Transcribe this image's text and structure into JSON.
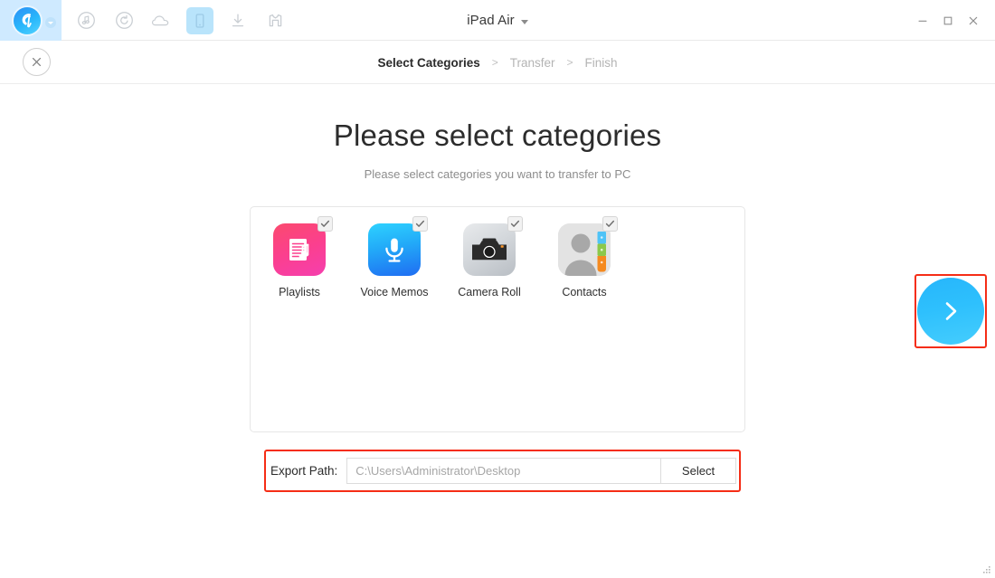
{
  "window": {
    "device_name": "iPad Air",
    "device_caret_icon": "chevron-down-icon",
    "minimize_icon": "minimize-icon",
    "maximize_icon": "maximize-icon",
    "close_icon": "close-icon"
  },
  "logo": {
    "name": "anytrans-logo",
    "letter": "A",
    "dropdown_icon": "caret-down-icon",
    "colors": {
      "start": "#2a8ef5",
      "end": "#54d3ff",
      "zone_bg": "#cfeaff"
    }
  },
  "toolbar": {
    "items": [
      {
        "name": "music-icon",
        "label": "Music",
        "active": false
      },
      {
        "name": "backup-restore-icon",
        "label": "Backup Manager",
        "active": false
      },
      {
        "name": "cloud-icon",
        "label": "Cloud",
        "active": false
      },
      {
        "name": "device-icon",
        "label": "Device Manager",
        "active": true
      },
      {
        "name": "download-icon",
        "label": "Media Downloader",
        "active": false
      },
      {
        "name": "app-downloader-icon",
        "label": "App Downloader",
        "active": false
      }
    ],
    "active_bg": "#b9e4fb"
  },
  "stepbar": {
    "close_button_icon": "close-circle-icon",
    "separator": ">",
    "steps": [
      {
        "label": "Select Categories",
        "current": true
      },
      {
        "label": "Transfer",
        "current": false
      },
      {
        "label": "Finish",
        "current": false
      }
    ]
  },
  "main": {
    "heading": "Please select categories",
    "subheading": "Please select categories you want to transfer to PC",
    "categories": [
      {
        "label": "Playlists",
        "icon": "playlists-icon",
        "checked": true,
        "style": "ic-playlists"
      },
      {
        "label": "Voice Memos",
        "icon": "voice-memos-icon",
        "checked": true,
        "style": "ic-voicememos"
      },
      {
        "label": "Camera Roll",
        "icon": "camera-roll-icon",
        "checked": true,
        "style": "ic-cameraroll"
      },
      {
        "label": "Contacts",
        "icon": "contacts-icon",
        "checked": true,
        "style": "ic-contacts"
      }
    ],
    "check_glyph": "checkmark-icon"
  },
  "export": {
    "label": "Export Path:",
    "path_value": "C:\\Users\\Administrator\\Desktop",
    "select_label": "Select"
  },
  "next_button": {
    "name": "next-arrow-button",
    "icon": "chevron-right-icon",
    "color_start": "#27b6fb",
    "color_end": "#45cdfd"
  },
  "annotations": {
    "color": "#f52d16",
    "targets": [
      "next-arrow-button",
      "export-path-row"
    ]
  }
}
